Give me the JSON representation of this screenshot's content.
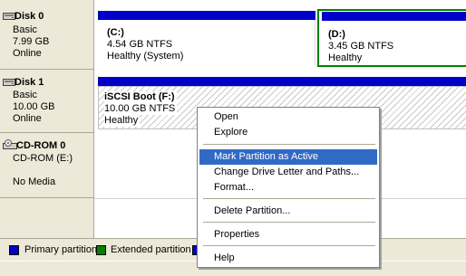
{
  "disks": [
    {
      "name": "Disk 0",
      "type": "Basic",
      "size": "7.99 GB",
      "status": "Online",
      "partitions": [
        {
          "label": "(C:)",
          "size_fs": "4.54 GB NTFS",
          "health": "Healthy (System)"
        },
        {
          "label": "(D:)",
          "size_fs": "3.45 GB NTFS",
          "health": "Healthy"
        }
      ]
    },
    {
      "name": "Disk 1",
      "type": "Basic",
      "size": "10.00 GB",
      "status": "Online",
      "partitions": [
        {
          "label": "iSCSI Boot  (F:)",
          "size_fs": "10.00 GB NTFS",
          "health": "Healthy"
        }
      ]
    },
    {
      "name": "CD-ROM 0",
      "type": "CD-ROM (E:)",
      "status": "No Media"
    }
  ],
  "legend": {
    "items": [
      {
        "label": "Primary partition",
        "color": "#0000c8"
      },
      {
        "label": "Extended partition",
        "color": "#008000"
      }
    ]
  },
  "context_menu": {
    "items": [
      "Open",
      "Explore",
      "Mark Partition as Active",
      "Change Drive Letter and Paths...",
      "Format...",
      "Delete Partition...",
      "Properties",
      "Help"
    ],
    "selected": "Mark Partition as Active"
  },
  "colors": {
    "primary": "#0000c8",
    "extended": "#008000",
    "selection": "#316ac5"
  },
  "icons": [
    "disk-icon",
    "cdrom-icon"
  ]
}
